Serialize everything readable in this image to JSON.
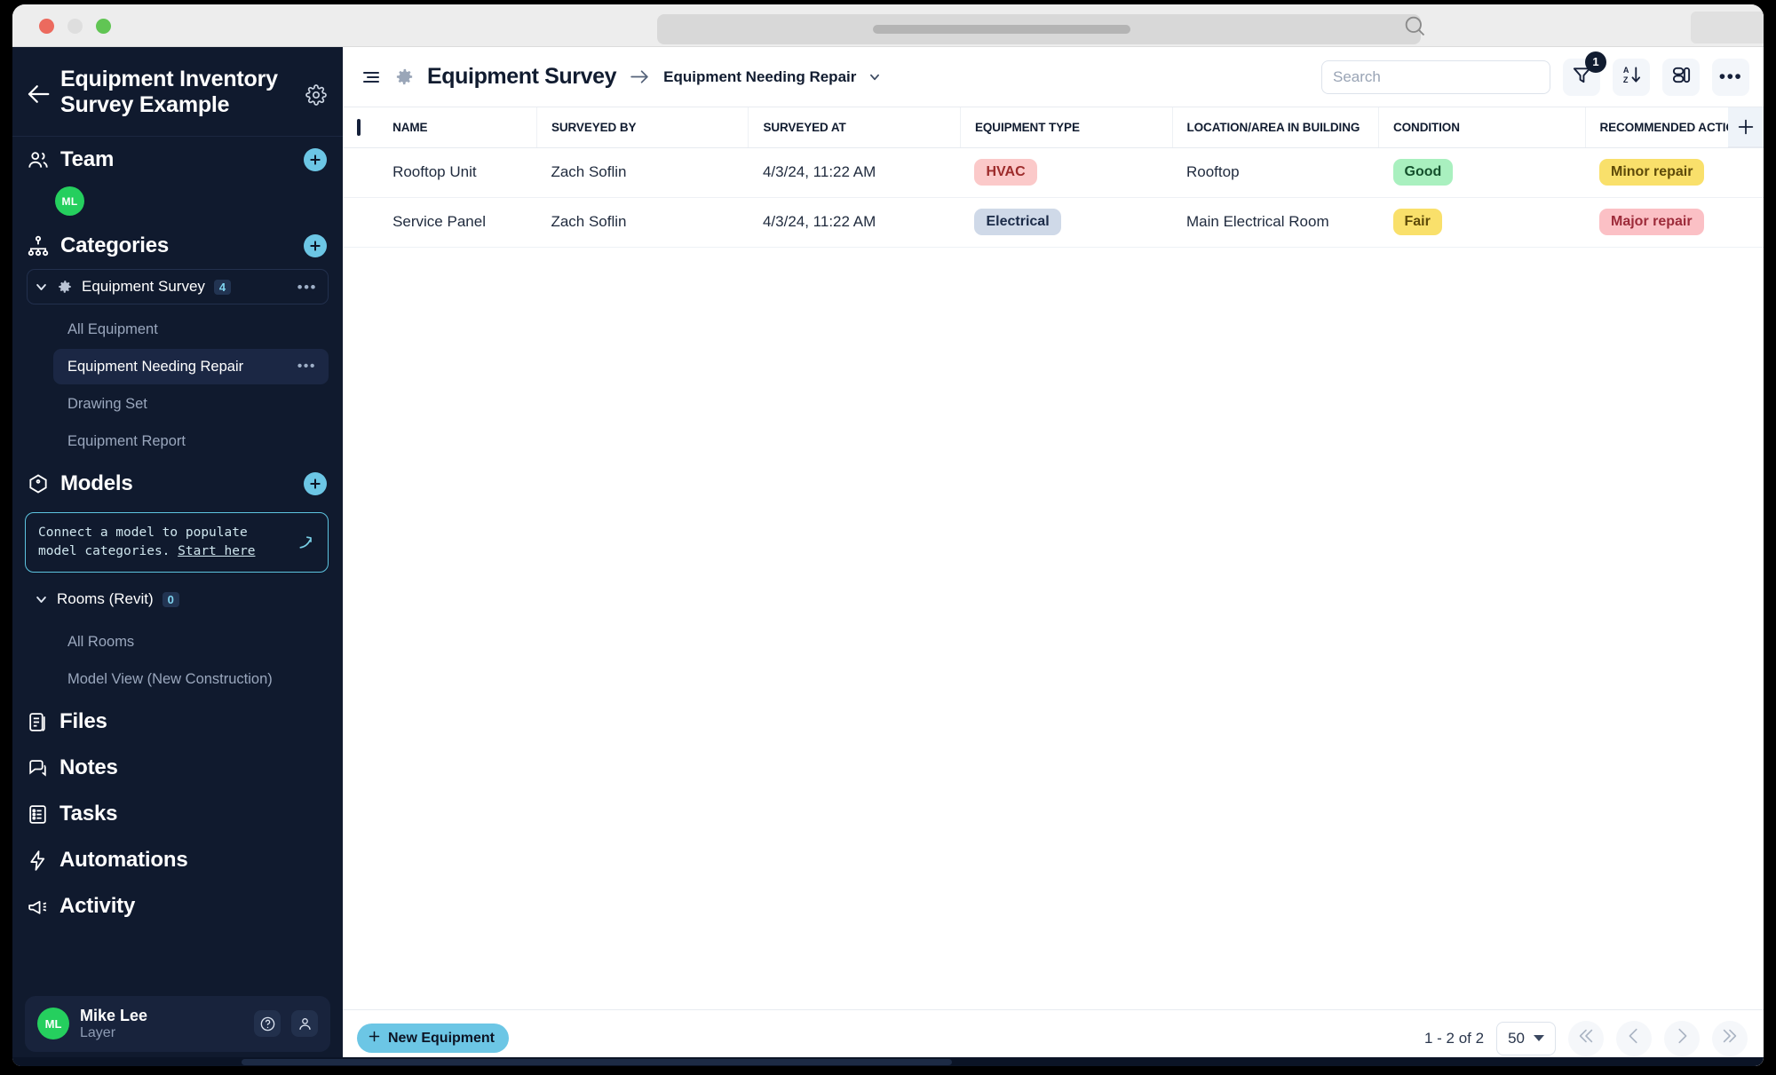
{
  "browser": {
    "traffic_lights": [
      "close",
      "minimize",
      "maximize"
    ],
    "url_placeholder": "",
    "search_icon": "search-icon"
  },
  "sidebar": {
    "project_title": "Equipment Inventory Survey Example",
    "back_icon": "arrow-left-icon",
    "settings_icon": "gear-icon",
    "sections": {
      "team": {
        "label": "Team",
        "icon": "people-icon",
        "add_label": "+",
        "members": [
          {
            "initials": "ML",
            "color": "#25cf5e"
          }
        ]
      },
      "categories": {
        "label": "Categories",
        "icon": "hierarchy-icon",
        "add_label": "+"
      },
      "models": {
        "label": "Models",
        "icon": "model-cube-icon",
        "add_label": "+"
      }
    },
    "category_groups": [
      {
        "label": "Equipment Survey",
        "icon": "gear-icon",
        "count": "4",
        "expanded": true,
        "children": [
          {
            "label": "All Equipment",
            "active": false
          },
          {
            "label": "Equipment Needing Repair",
            "active": true
          },
          {
            "label": "Drawing Set",
            "active": false
          },
          {
            "label": "Equipment Report",
            "active": false
          }
        ]
      }
    ],
    "connect_banner": {
      "text": "Connect a model to populate model categories. ",
      "link": "Start here",
      "icon": "arrow-up-right-icon"
    },
    "model_groups": [
      {
        "label": "Rooms (Revit)",
        "count": "0",
        "expanded": true,
        "children": [
          {
            "label": "All Rooms",
            "active": false
          },
          {
            "label": "Model View (New Construction)",
            "active": false
          }
        ]
      }
    ],
    "nav_items": [
      {
        "label": "Files",
        "icon": "files-icon"
      },
      {
        "label": "Notes",
        "icon": "notes-icon"
      },
      {
        "label": "Tasks",
        "icon": "tasks-icon"
      },
      {
        "label": "Automations",
        "icon": "lightning-icon"
      },
      {
        "label": "Activity",
        "icon": "megaphone-icon"
      }
    ],
    "user": {
      "initials": "ML",
      "name": "Mike Lee",
      "org": "Layer",
      "help_icon": "question-circle-icon",
      "account_icon": "person-icon"
    }
  },
  "topbar": {
    "menu_icon": "hamburger-menu-icon",
    "breadcrumb_icon": "gear-icon",
    "breadcrumb_title": "Equipment Survey",
    "breadcrumb_arrow": "arrow-right-icon",
    "current_view": "Equipment Needing Repair",
    "view_chevron": "chevron-down-icon",
    "search_placeholder": "Search",
    "search_value": "",
    "filter": {
      "icon": "filter-icon",
      "badge": "1"
    },
    "sort": {
      "icon": "sort-az-icon"
    },
    "layout": {
      "icon": "layout-columns-icon"
    },
    "more": {
      "icon": "ellipsis-icon",
      "label": "•••"
    }
  },
  "table": {
    "select_all_checked": false,
    "columns": [
      "NAME",
      "SURVEYED BY",
      "SURVEYED AT",
      "EQUIPMENT TYPE",
      "LOCATION/AREA IN BUILDING",
      "CONDITION",
      "RECOMMENDED ACTIONS"
    ],
    "add_column_icon": "plus-icon",
    "rows": [
      {
        "name": "Rooftop Unit",
        "surveyed_by": "Zach Soflin",
        "surveyed_at": "4/3/24, 11:22 AM",
        "equipment_type": {
          "text": "HVAC",
          "bg": "#fbc9c9",
          "fg": "#9d2b2b"
        },
        "location": "Rooftop",
        "condition": {
          "text": "Good",
          "bg": "#a9f0bf",
          "fg": "#14502c"
        },
        "recommended": {
          "text": "Minor repair",
          "bg": "#f9e06b",
          "fg": "#5d4a09"
        }
      },
      {
        "name": "Service Panel",
        "surveyed_by": "Zach Soflin",
        "surveyed_at": "4/3/24, 11:22 AM",
        "equipment_type": {
          "text": "Electrical",
          "bg": "#cfd9e8",
          "fg": "#1b2b48"
        },
        "location": "Main Electrical Room",
        "condition": {
          "text": "Fair",
          "bg": "#f9e06b",
          "fg": "#5d4a09"
        },
        "recommended": {
          "text": "Major repair",
          "bg": "#fbc0c5",
          "fg": "#9d2b3a"
        }
      }
    ]
  },
  "footer": {
    "new_button": "New Equipment",
    "new_button_icon": "plus-icon",
    "page_count": "1 - 2 of 2",
    "page_size": "50",
    "first_icon": "chevrons-left-icon",
    "prev_icon": "chevron-left-icon",
    "next_icon": "chevron-right-icon",
    "last_icon": "chevrons-right-icon"
  }
}
